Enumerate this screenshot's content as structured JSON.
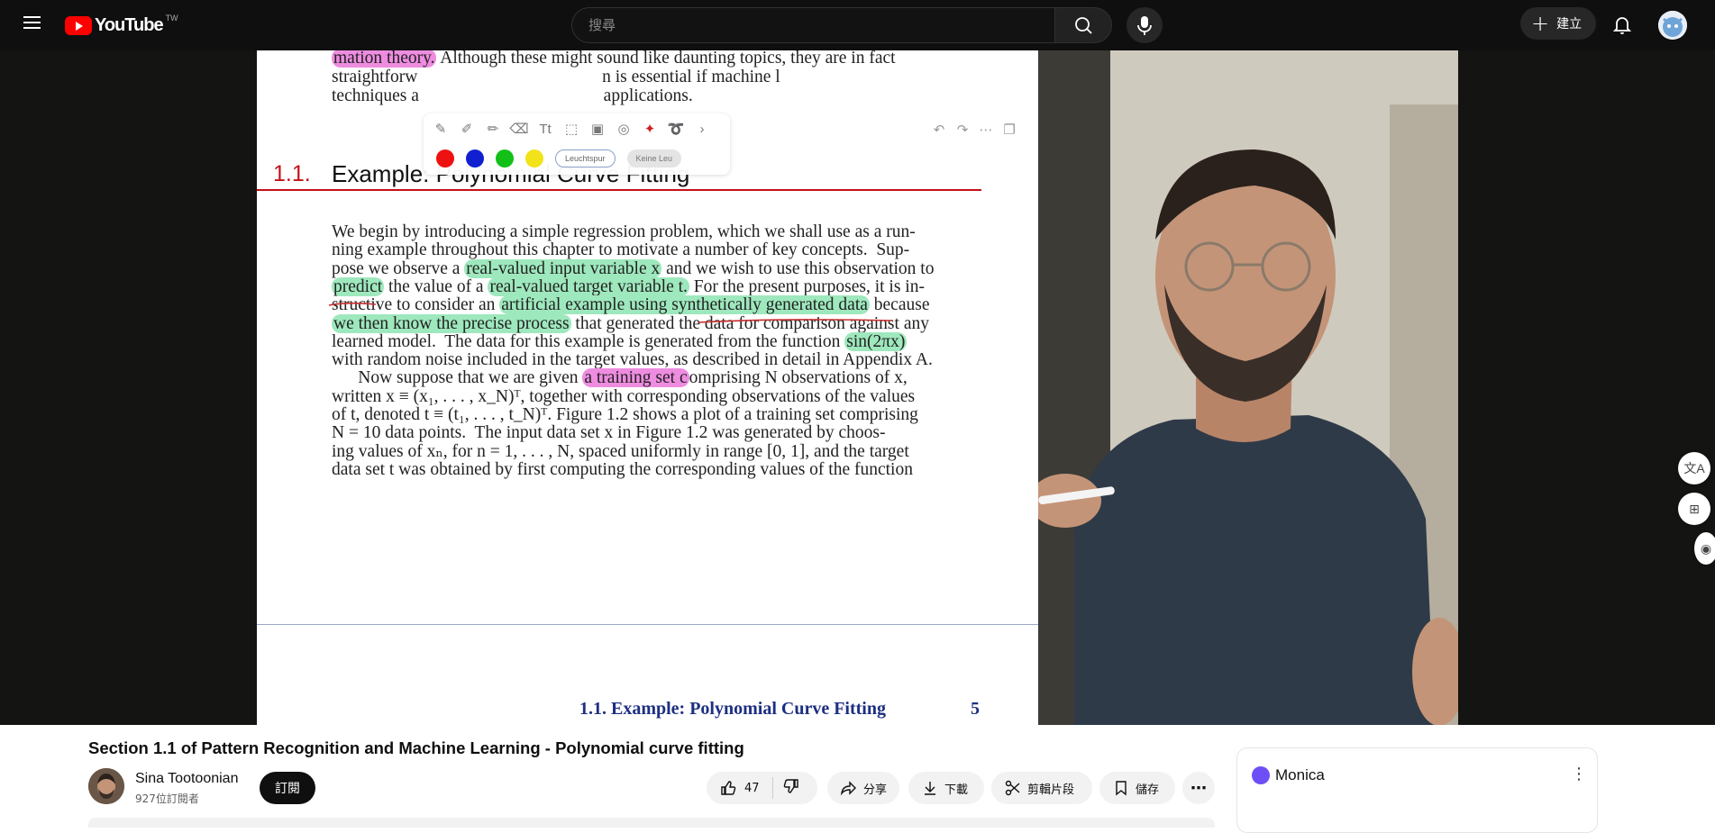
{
  "topbar": {
    "logo_text": "YouTube",
    "logo_region": "TW",
    "search_placeholder": "搜尋",
    "create_label": "建立",
    "colors": {
      "background": "#0f0f0f",
      "brand_red": "#ff0000"
    }
  },
  "pdf": {
    "top_lines": [
      {
        "parts": [
          {
            "t": "mation theory.",
            "hl": "p"
          },
          {
            "t": " Although these might sound like daunting topics, they are in fact",
            "hl": ""
          }
        ]
      },
      {
        "parts": [
          {
            "t": "straightforw",
            "hl": ""
          },
          {
            "t": "                                          ",
            "hl": ""
          },
          {
            "t": "n is essential if machine l",
            "hl": ""
          }
        ]
      },
      {
        "parts": [
          {
            "t": "techniques a",
            "hl": ""
          },
          {
            "t": "                                          ",
            "hl": ""
          },
          {
            "t": "applications.",
            "hl": ""
          }
        ]
      }
    ],
    "section_number": "1.1.",
    "section_title": "Example: Polynomial Curve Fitting",
    "body_lines": [
      [
        {
          "t": "We begin by introducing a simple regression problem, which we shall use as a run-",
          "hl": ""
        }
      ],
      [
        {
          "t": "ning example throughout this chapter to motivate a number of key concepts.  Sup-",
          "hl": ""
        }
      ],
      [
        {
          "t": "pose we observe a ",
          "hl": ""
        },
        {
          "t": "real-valued input variable x",
          "hl": "g"
        },
        {
          "t": " and we wish to use this observation to",
          "hl": ""
        }
      ],
      [
        {
          "t": "predict",
          "hl": "g"
        },
        {
          "t": " the value of a ",
          "hl": ""
        },
        {
          "t": "real-valued target variable t.",
          "hl": "g"
        },
        {
          "t": " For the present purposes, it is in-",
          "hl": ""
        }
      ],
      [
        {
          "t": "structive to consider an ",
          "hl": ""
        },
        {
          "t": "artificial example using synthetically generated data",
          "hl": "g"
        },
        {
          "t": " because",
          "hl": ""
        }
      ],
      [
        {
          "t": "we then know the precise process",
          "hl": "g"
        },
        {
          "t": " that generated the data for comparison against any",
          "hl": ""
        }
      ],
      [
        {
          "t": "learned model.  The data for this example is generated from the function ",
          "hl": ""
        },
        {
          "t": "sin(2πx)",
          "hl": "g"
        }
      ],
      [
        {
          "t": "with random noise included in the target values, as described in detail in Appendix A.",
          "hl": ""
        }
      ],
      [
        {
          "t": "      Now suppose that we are given ",
          "hl": ""
        },
        {
          "t": "a training set c",
          "hl": "p"
        },
        {
          "t": "omprising N observations of x,",
          "hl": ""
        }
      ],
      [
        {
          "t": "written x ≡ (x₁, . . . , x_N)ᵀ, together with corresponding observations of the values",
          "hl": ""
        }
      ],
      [
        {
          "t": "of t, denoted t ≡ (t₁, . . . , t_N)ᵀ. Figure 1.2 shows a plot of a training set comprising",
          "hl": ""
        }
      ],
      [
        {
          "t": "N = 10 data points.  The input data set x in Figure 1.2 was generated by choos-",
          "hl": ""
        }
      ],
      [
        {
          "t": "ing values of xₙ, for n = 1, . . . , N, spaced uniformly in range [0, 1], and the target",
          "hl": ""
        }
      ],
      [
        {
          "t": "data set t was obtained by first computing the corresponding values of the function",
          "hl": ""
        }
      ]
    ],
    "running_head": "1.1. Example: Polynomial Curve Fitting",
    "page_number": "5",
    "annotation_toolbar": {
      "pill_1": "Leuchtspur",
      "pill_2": "Keine Leu",
      "colors": [
        "#ee1111",
        "#1020d0",
        "#12c018",
        "#f2e21a"
      ]
    }
  },
  "video": {
    "title": "Section 1.1 of Pattern Recognition and Machine Learning - Polynomial curve fitting",
    "channel_name": "Sina Tootoonian",
    "subscribers": "927位訂閱者",
    "subscribe_label": "訂閱",
    "like_count": "47",
    "share_label": "分享",
    "download_label": "下載",
    "clip_label": "剪輯片段",
    "save_label": "儲存"
  },
  "monica": {
    "label": "Monica"
  }
}
